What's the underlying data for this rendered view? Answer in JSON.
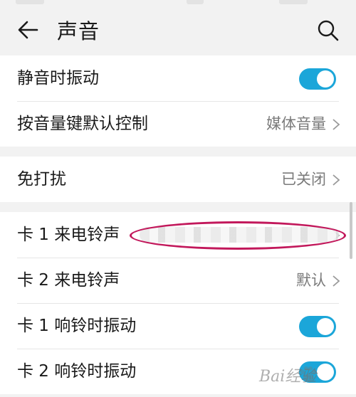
{
  "header": {
    "title": "声音",
    "back_icon": "arrow-left-icon",
    "search_icon": "search-icon"
  },
  "groups": [
    {
      "rows": [
        {
          "label": "静音时振动",
          "control": "toggle",
          "on": true
        },
        {
          "label": "按音量键默认控制",
          "value": "媒体音量",
          "control": "chevron"
        }
      ]
    },
    {
      "rows": [
        {
          "label": "免打扰",
          "value": "已关闭",
          "control": "chevron"
        }
      ]
    },
    {
      "rows": [
        {
          "label": "卡 1 来电铃声",
          "value": "",
          "control": "chevron"
        },
        {
          "label": "卡 2 来电铃声",
          "value": "默认",
          "control": "chevron"
        },
        {
          "label": "卡 1 响铃时振动",
          "control": "toggle",
          "on": true
        },
        {
          "label": "卡 2 响铃时振动",
          "control": "toggle",
          "on": true
        }
      ]
    }
  ],
  "watermark": {
    "text": "Bai经验"
  },
  "colors": {
    "accent": "#1ba6d9",
    "annotation": "#c2185b",
    "background": "#f2f2f2"
  }
}
